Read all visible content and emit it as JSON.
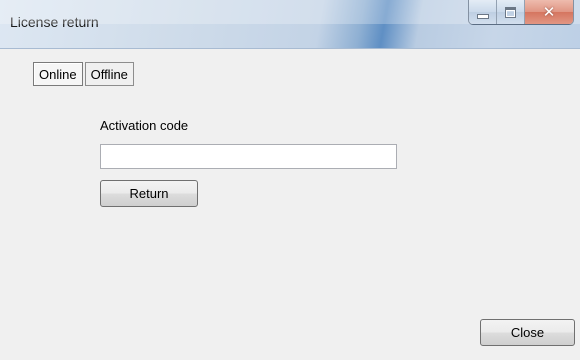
{
  "window": {
    "title": "License return"
  },
  "tabs": [
    {
      "label": "Online",
      "active": true
    },
    {
      "label": "Offline",
      "active": false
    }
  ],
  "form": {
    "activation_label": "Activation code",
    "activation_value": "",
    "return_label": "Return"
  },
  "footer": {
    "close_label": "Close"
  },
  "icons": {
    "minimize": "minimize-icon",
    "maximize": "maximize-icon",
    "close": "close-icon"
  },
  "colors": {
    "close_button": "#c7482b",
    "titlebar": "#cfdcea"
  }
}
